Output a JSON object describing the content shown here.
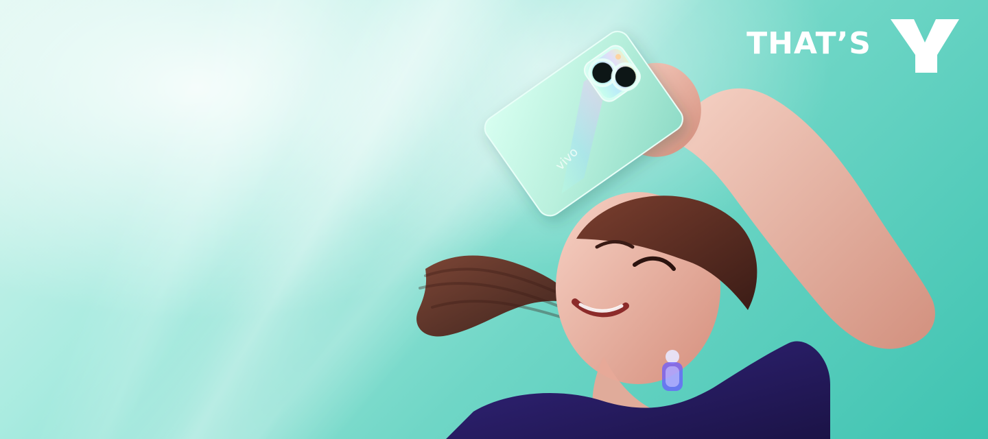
{
  "banner": {
    "tagline": {
      "text": "THAT’S",
      "mark_icon": "y-logo-icon"
    },
    "phone": {
      "brand_text": "vivo",
      "body_color": "#b9f0dd",
      "camera_ring_color": "#e9fff8"
    },
    "colors": {
      "background_light": "#d9f6ef",
      "background_mid": "#6fd6c6",
      "background_dark": "#3ec3b1",
      "shirt": "#2b1f6b",
      "hair": "#6b3a2c",
      "skin": "#f0b9a6"
    }
  }
}
